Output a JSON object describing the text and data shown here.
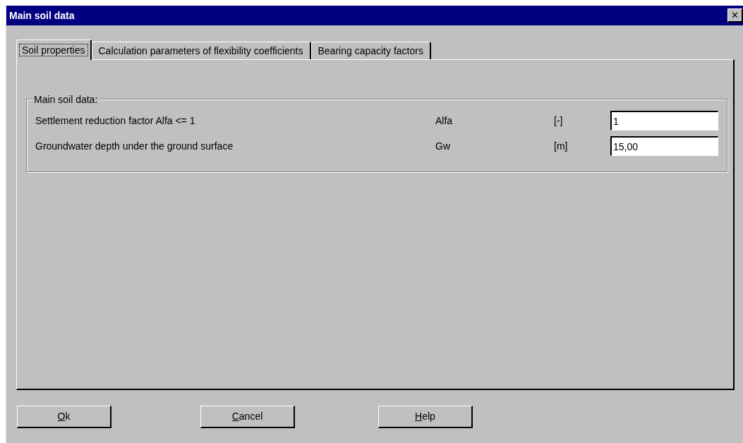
{
  "window": {
    "title": "Main soil data",
    "close": "✕"
  },
  "tabs": [
    {
      "label": "Soil properties",
      "selected": true
    },
    {
      "label": "Calculation parameters of flexibility coefficients",
      "selected": false
    },
    {
      "label": "Bearing capacity factors",
      "selected": false
    }
  ],
  "group": {
    "title": "Main soil data:",
    "rows": [
      {
        "label": "Settlement reduction factor Alfa <= 1",
        "symbol": "Alfa",
        "unit": "[-]",
        "value": "1"
      },
      {
        "label": "Groundwater depth under the ground surface",
        "symbol": "Gw",
        "unit": "[m]",
        "value": "15,00"
      }
    ]
  },
  "buttons": [
    {
      "mnemonic": "O",
      "rest": "k"
    },
    {
      "mnemonic": "C",
      "rest": "ancel"
    },
    {
      "mnemonic": "H",
      "rest": "elp"
    }
  ]
}
